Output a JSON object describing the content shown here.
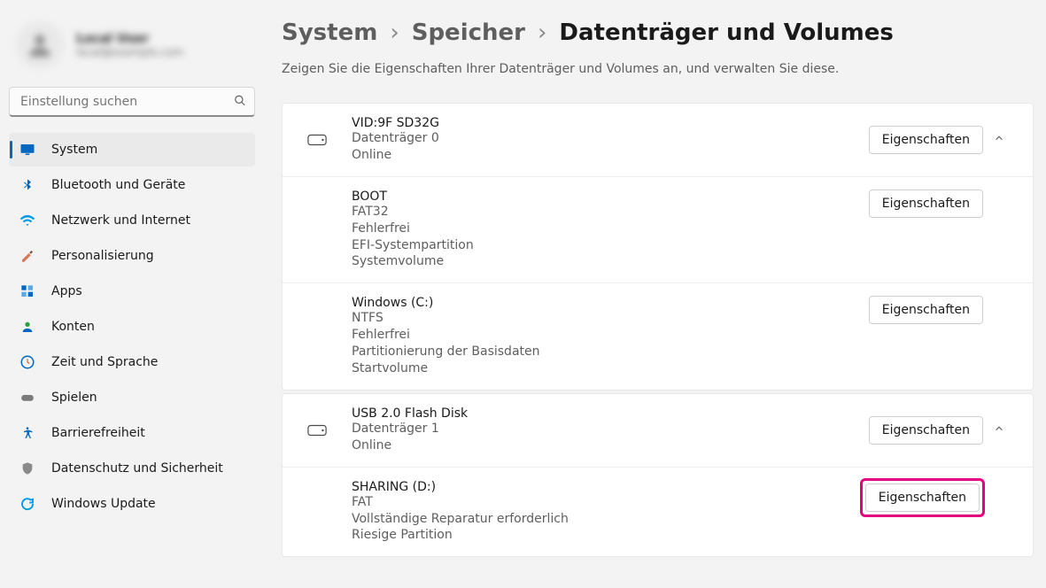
{
  "user": {
    "name": "Local User",
    "email": "local@example.com"
  },
  "search": {
    "placeholder": "Einstellung suchen"
  },
  "nav": {
    "system": "System",
    "bluetooth": "Bluetooth und Geräte",
    "network": "Netzwerk und Internet",
    "personalization": "Personalisierung",
    "apps": "Apps",
    "accounts": "Konten",
    "time": "Zeit und Sprache",
    "gaming": "Spielen",
    "accessibility": "Barrierefreiheit",
    "privacy": "Datenschutz und Sicherheit",
    "update": "Windows Update"
  },
  "breadcrumb": {
    "system": "System",
    "storage": "Speicher",
    "current": "Datenträger und Volumes"
  },
  "subtitle": "Zeigen Sie die Eigenschaften Ihrer Datenträger und Volumes an, und verwalten Sie diese.",
  "buttons": {
    "properties": "Eigenschaften"
  },
  "disks": [
    {
      "name": "VID:9F SD32G",
      "index": "Datenträger 0",
      "status": "Online",
      "volumes": [
        {
          "name": "BOOT",
          "fs": "FAT32",
          "health": "Fehlerfrei",
          "type1": "EFI-Systempartition",
          "type2": "Systemvolume"
        },
        {
          "name": "Windows (C:)",
          "fs": "NTFS",
          "health": "Fehlerfrei",
          "type1": "Partitionierung der Basisdaten",
          "type2": "Startvolume"
        }
      ]
    },
    {
      "name": "USB 2.0 Flash Disk",
      "index": "Datenträger 1",
      "status": "Online",
      "volumes": [
        {
          "name": "SHARING (D:)",
          "fs": "FAT",
          "health": "Vollständige Reparatur erforderlich",
          "type1": "Riesige Partition",
          "type2": ""
        }
      ]
    }
  ]
}
